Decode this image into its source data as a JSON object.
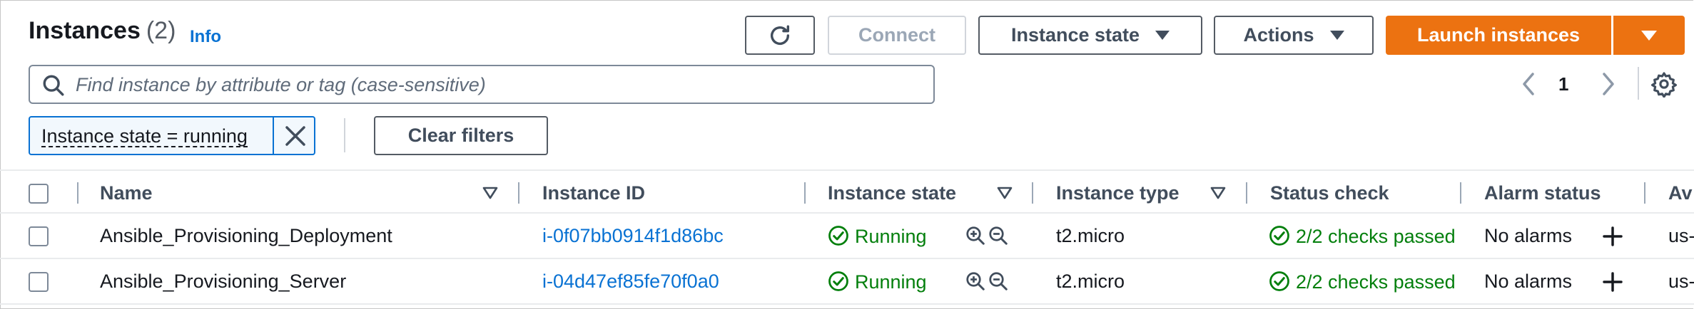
{
  "header": {
    "title": "Instances",
    "count": "(2)",
    "info": "Info"
  },
  "toolbar": {
    "connect": "Connect",
    "instance_state": "Instance state",
    "actions": "Actions",
    "launch": "Launch instances"
  },
  "search": {
    "placeholder": "Find instance by attribute or tag (case-sensitive)",
    "value": ""
  },
  "pagination": {
    "page": "1"
  },
  "filter": {
    "token": "Instance state = running",
    "clear": "Clear filters"
  },
  "table": {
    "columns": [
      "Name",
      "Instance ID",
      "Instance state",
      "Instance type",
      "Status check",
      "Alarm status",
      "Av"
    ],
    "rows": [
      {
        "name": "Ansible_Provisioning_Deployment",
        "id": "i-0f07bb0914f1d86bc",
        "state": "Running",
        "type": "t2.micro",
        "status": "2/2 checks passed",
        "alarm": "No alarms",
        "az": "us-"
      },
      {
        "name": "Ansible_Provisioning_Server",
        "id": "i-04d47ef85fe70f0a0",
        "state": "Running",
        "type": "t2.micro",
        "status": "2/2 checks passed",
        "alarm": "No alarms",
        "az": "us-"
      }
    ]
  },
  "colors": {
    "accent": "#0972d3",
    "launch": "#ec7211",
    "success": "#037f0c"
  },
  "icons": [
    "refresh-icon",
    "caret-down-icon",
    "search-icon",
    "chevron-left-icon",
    "chevron-right-icon",
    "gear-icon",
    "close-icon",
    "sort-icon",
    "check-circle-icon",
    "zoom-in-icon",
    "zoom-out-icon",
    "plus-icon"
  ]
}
